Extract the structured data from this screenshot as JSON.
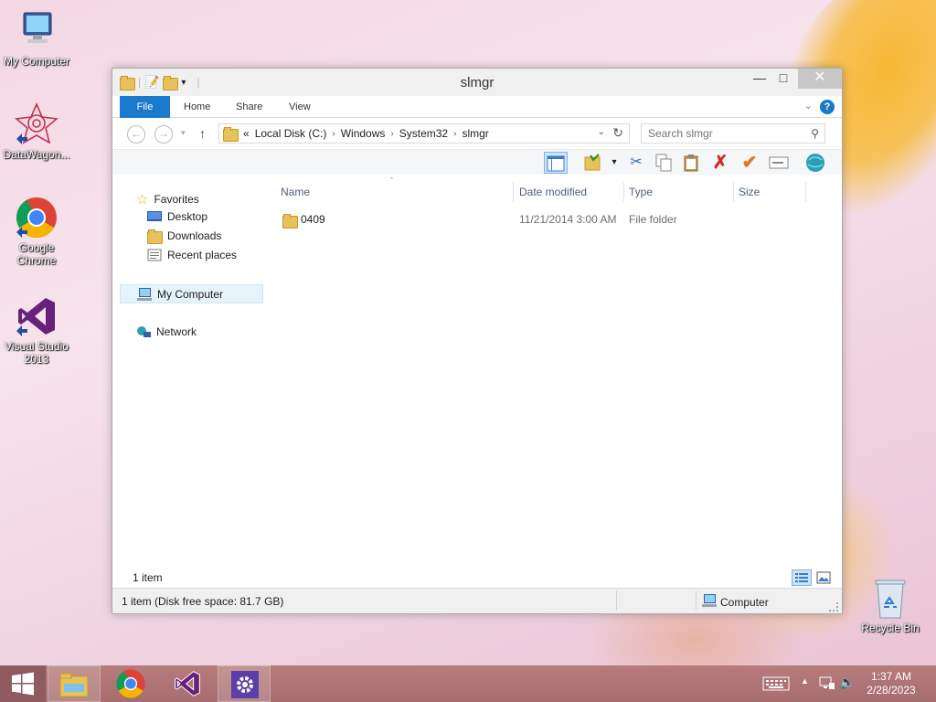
{
  "desktop": {
    "icons": [
      {
        "label": "My Computer"
      },
      {
        "label": "DataWagon..."
      },
      {
        "label": "Google Chrome"
      },
      {
        "label": "Visual Studio 2013"
      },
      {
        "label": "Recycle Bin"
      }
    ]
  },
  "window": {
    "title": "slmgr",
    "ribbon_tabs": {
      "file": "File",
      "home": "Home",
      "share": "Share",
      "view": "View"
    },
    "help": "?",
    "address": {
      "overflow": "«",
      "crumbs": [
        "Local Disk (C:)",
        "Windows",
        "System32",
        "slmgr"
      ]
    },
    "search": {
      "placeholder": "Search slmgr"
    },
    "nav_pane": {
      "favorites": "Favorites",
      "desktop": "Desktop",
      "downloads": "Downloads",
      "recent": "Recent places",
      "computer": "My Computer",
      "network": "Network"
    },
    "columns": {
      "name": "Name",
      "date": "Date modified",
      "type": "Type",
      "size": "Size"
    },
    "files": [
      {
        "name": "0409",
        "date": "11/21/2014 3:00 AM",
        "type": "File folder",
        "size": ""
      }
    ],
    "item_count": "1 item",
    "status": {
      "left": "1 item (Disk free space: 81.7 GB)",
      "right": "Computer"
    }
  },
  "taskbar": {
    "time": "1:37 AM",
    "date": "2/28/2023"
  },
  "colors": {
    "accent": "#1979ca",
    "taskbar": "#b07476"
  }
}
